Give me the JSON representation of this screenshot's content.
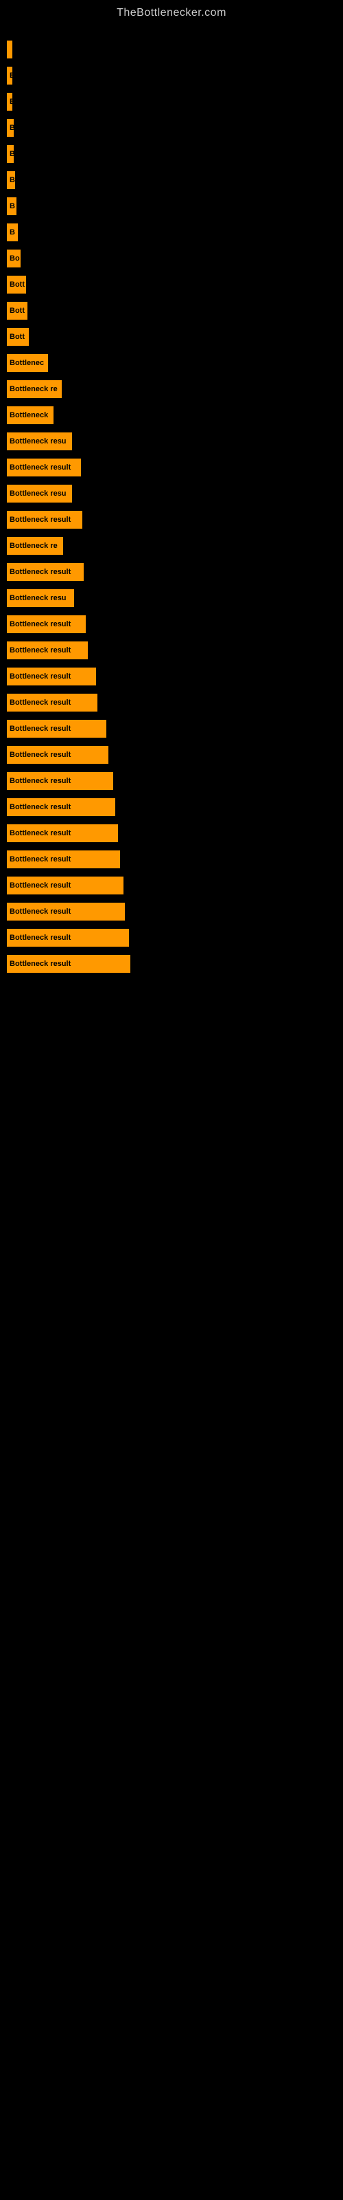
{
  "site": {
    "title": "TheBottlenecker.com"
  },
  "bars": [
    {
      "label": "",
      "width": 4,
      "visible_text": ""
    },
    {
      "label": "B",
      "width": 8,
      "visible_text": "B"
    },
    {
      "label": "B",
      "width": 8,
      "visible_text": "B"
    },
    {
      "label": "B",
      "width": 10,
      "visible_text": "B"
    },
    {
      "label": "B",
      "width": 10,
      "visible_text": "B"
    },
    {
      "label": "B",
      "width": 12,
      "visible_text": "B"
    },
    {
      "label": "B",
      "width": 14,
      "visible_text": "B"
    },
    {
      "label": "B",
      "width": 16,
      "visible_text": "B"
    },
    {
      "label": "Bo",
      "width": 20,
      "visible_text": "Bo"
    },
    {
      "label": "Bott",
      "width": 28,
      "visible_text": "Bott"
    },
    {
      "label": "Bott",
      "width": 30,
      "visible_text": "Bott"
    },
    {
      "label": "Bott",
      "width": 32,
      "visible_text": "Bott"
    },
    {
      "label": "Bottlenec",
      "width": 60,
      "visible_text": "Bottlenec"
    },
    {
      "label": "Bottleneck re",
      "width": 80,
      "visible_text": "Bottleneck re"
    },
    {
      "label": "Bottleneck",
      "width": 68,
      "visible_text": "Bottleneck"
    },
    {
      "label": "Bottleneck resu",
      "width": 95,
      "visible_text": "Bottleneck resu"
    },
    {
      "label": "Bottleneck result",
      "width": 108,
      "visible_text": "Bottleneck result"
    },
    {
      "label": "Bottleneck resu",
      "width": 95,
      "visible_text": "Bottleneck resu"
    },
    {
      "label": "Bottleneck result",
      "width": 110,
      "visible_text": "Bottleneck result"
    },
    {
      "label": "Bottleneck re",
      "width": 82,
      "visible_text": "Bottleneck re"
    },
    {
      "label": "Bottleneck result",
      "width": 112,
      "visible_text": "Bottleneck result"
    },
    {
      "label": "Bottleneck resu",
      "width": 98,
      "visible_text": "Bottleneck resu"
    },
    {
      "label": "Bottleneck result",
      "width": 115,
      "visible_text": "Bottleneck result"
    },
    {
      "label": "Bottleneck result",
      "width": 118,
      "visible_text": "Bottleneck result"
    },
    {
      "label": "Bottleneck result",
      "width": 130,
      "visible_text": "Bottleneck result"
    },
    {
      "label": "Bottleneck result",
      "width": 132,
      "visible_text": "Bottleneck result"
    },
    {
      "label": "Bottleneck result",
      "width": 145,
      "visible_text": "Bottleneck result"
    },
    {
      "label": "Bottleneck result",
      "width": 148,
      "visible_text": "Bottleneck result"
    },
    {
      "label": "Bottleneck result",
      "width": 155,
      "visible_text": "Bottleneck result"
    },
    {
      "label": "Bottleneck result",
      "width": 158,
      "visible_text": "Bottleneck result"
    },
    {
      "label": "Bottleneck result",
      "width": 162,
      "visible_text": "Bottleneck result"
    },
    {
      "label": "Bottleneck result",
      "width": 165,
      "visible_text": "Bottleneck result"
    },
    {
      "label": "Bottleneck result",
      "width": 170,
      "visible_text": "Bottleneck result"
    },
    {
      "label": "Bottleneck result",
      "width": 172,
      "visible_text": "Bottleneck result"
    },
    {
      "label": "Bottleneck result",
      "width": 178,
      "visible_text": "Bottleneck result"
    },
    {
      "label": "Bottleneck result",
      "width": 180,
      "visible_text": "Bottleneck result"
    }
  ]
}
